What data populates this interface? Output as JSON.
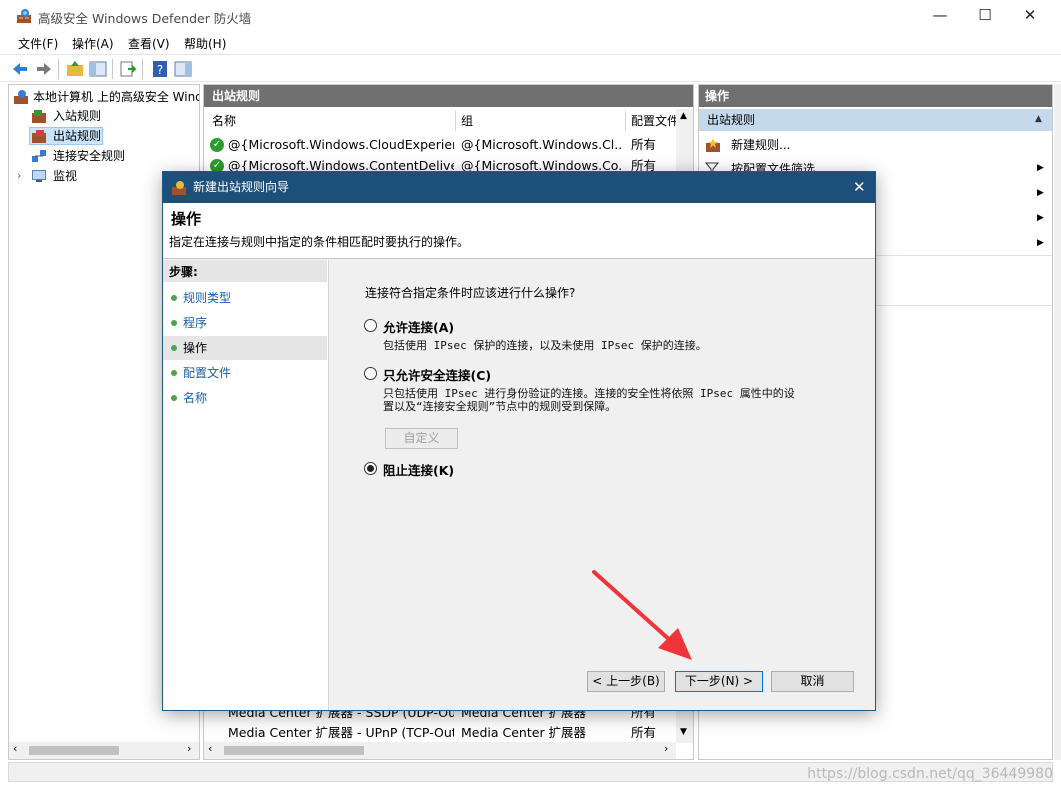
{
  "window": {
    "title": "高级安全 Windows Defender 防火墙",
    "minimize": "—",
    "maximize": "☐",
    "close": "✕"
  },
  "menu": [
    "文件(F)",
    "操作(A)",
    "查看(V)",
    "帮助(H)"
  ],
  "tree": {
    "root": "本地计算机 上的高级安全 Windows Defender 防火墙",
    "items": [
      "入站规则",
      "出站规则",
      "连接安全规则",
      "监视"
    ]
  },
  "center": {
    "header": "出站规则",
    "columns": [
      "名称",
      "组",
      "配置文件"
    ],
    "rows_top": [
      {
        "name": "@{Microsoft.Windows.CloudExperien...",
        "group": "@{Microsoft.Windows.Cl...",
        "profile": "所有"
      },
      {
        "name": "@{Microsoft.Windows.ContentDeliver...",
        "group": "@{Microsoft.Windows.Co...",
        "profile": "所有"
      }
    ],
    "rows_bottom": [
      {
        "name": "Media Center 扩展器 - SSDP (UDP-Out)",
        "group": "Media Center 扩展器",
        "profile": "所有"
      },
      {
        "name": "Media Center 扩展器 - UPnP (TCP-Out)",
        "group": "Media Center 扩展器",
        "profile": "所有"
      }
    ]
  },
  "actions": {
    "header": "操作",
    "section": "出站规则",
    "items": [
      "新建规则...",
      "按配置文件筛选"
    ]
  },
  "dialog": {
    "title": "新建出站规则向导",
    "heading": "操作",
    "subheading": "指定在连接与规则中指定的条件相匹配时要执行的操作。",
    "steps_label": "步骤:",
    "steps": [
      "规则类型",
      "程序",
      "操作",
      "配置文件",
      "名称"
    ],
    "question": "连接符合指定条件时应该进行什么操作?",
    "options": [
      {
        "title": "允许连接(A)",
        "desc": "包括使用 IPsec 保护的连接，以及未使用 IPsec 保护的连接。",
        "selected": false
      },
      {
        "title": "只允许安全连接(C)",
        "desc_line1": "只包括使用 IPsec 进行身份验证的连接。连接的安全性将依照 IPsec 属性中的设",
        "desc_line2": "置以及“连接安全规则”节点中的规则受到保障。",
        "selected": false
      },
      {
        "title": "阻止连接(K)",
        "selected": true
      }
    ],
    "customize_button": "自定义",
    "back_button": "< 上一步(B)",
    "next_button": "下一步(N) >",
    "cancel_button": "取消"
  },
  "watermark": "https://blog.csdn.net/qq_36449980",
  "colors": {
    "header_gray": "#707070",
    "dialog_title": "#1c4f79",
    "link_blue": "#1a5fa6",
    "selection_blue": "#c5d9ec",
    "arrow_red": "#f0343c"
  }
}
